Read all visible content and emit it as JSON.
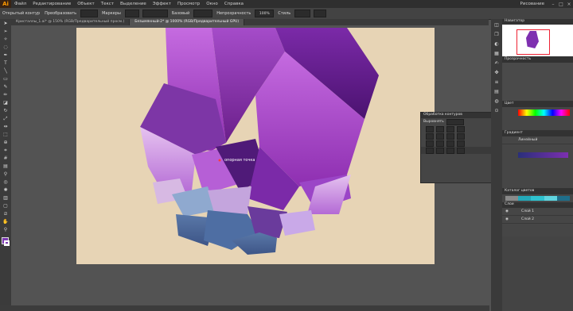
{
  "app": {
    "logo": "Ai",
    "workspace": "Рисование"
  },
  "menu": [
    "Файл",
    "Редактирование",
    "Объект",
    "Текст",
    "Выделение",
    "Эффект",
    "Просмотр",
    "Окно",
    "Справка"
  ],
  "control": {
    "selection_label": "Открытый контур",
    "transform_label": "Преобразовать",
    "anchor_label": "Маркеры",
    "stroke_style": "Базовый",
    "opacity_label": "Непрозрачность",
    "opacity_value": "100%",
    "style_label": "Стиль"
  },
  "tabs": [
    "Кристаллы_1.ai* @ 150% (RGB/Предварительный просм.)",
    "Безымянный-2* @ 1000% (RGB/Предварительный GPU)"
  ],
  "canvas": {
    "cursor_label": "опорная точка"
  },
  "panels": {
    "navigator": "Навигатор",
    "color_tab": "Цвет",
    "gradient_tab": "Градиент",
    "gradient_type": "Линейный",
    "layers_title": "Каталог цветов",
    "layers_tab": "Слои",
    "layer1": "Слой 1",
    "layer2": "Слой 2",
    "pathfinder_title": "Обработка контуров",
    "align_title": "Выровнять",
    "transparency": "Прозрачность"
  },
  "colors": {
    "accent": "#ff9a00",
    "crystal_dark": "#5a1e8a",
    "crystal_light": "#c79be6",
    "base_blue": "#4a6a9c",
    "artboard": "#e7d4b5"
  }
}
